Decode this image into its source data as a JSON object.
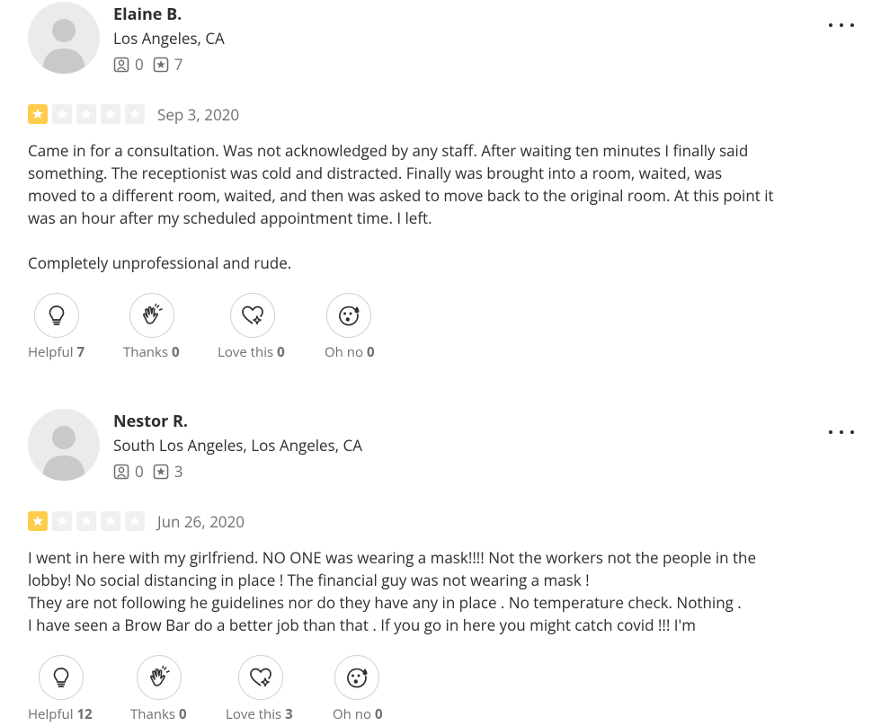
{
  "reviews": [
    {
      "name": "Elaine B.",
      "location": "Los Angeles, CA",
      "friends": "0",
      "review_count": "7",
      "rating": 1,
      "date": "Sep 3, 2020",
      "paragraphs": [
        "Came in for a consultation. Was not acknowledged by any staff. After waiting ten minutes I finally said something. The receptionist was cold and distracted. Finally was brought into a room, waited, was moved to a different room, waited, and then was asked to move back to the original room. At this point it was an hour after my scheduled appointment time. I left.",
        "Completely unprofessional and rude."
      ],
      "reactions": {
        "helpful_label": "Helpful",
        "helpful_count": "7",
        "thanks_label": "Thanks",
        "thanks_count": "0",
        "love_label": "Love this",
        "love_count": "0",
        "ohno_label": "Oh no",
        "ohno_count": "0"
      }
    },
    {
      "name": "Nestor R.",
      "location": "South Los Angeles, Los Angeles, CA",
      "friends": "0",
      "review_count": "3",
      "rating": 1,
      "date": "Jun 26, 2020",
      "paragraphs": [
        "I went in here with my girlfriend. NO ONE was wearing a mask!!!! Not the workers not the people in the lobby! No social distancing in place ! The financial guy was not wearing a mask !\nThey are not following he guidelines nor do they have any in place . No temperature check. Nothing .\nI have seen a Brow Bar do a better job than that . If you go in here you might catch covid !!! I'm"
      ],
      "reactions": {
        "helpful_label": "Helpful",
        "helpful_count": "12",
        "thanks_label": "Thanks",
        "thanks_count": "0",
        "love_label": "Love this",
        "love_count": "3",
        "ohno_label": "Oh no",
        "ohno_count": "0"
      }
    }
  ],
  "colors": {
    "star_on": "#ffcc4b",
    "star_off": "#f0f0f0",
    "text": "#2d2e2f",
    "muted": "#6e7072"
  },
  "icons": [
    "user-avatar-icon",
    "friends-icon",
    "review-count-icon",
    "more-icon",
    "star-icon",
    "lightbulb-icon",
    "clapping-hands-icon",
    "heart-sparkle-icon",
    "surprised-face-icon"
  ]
}
